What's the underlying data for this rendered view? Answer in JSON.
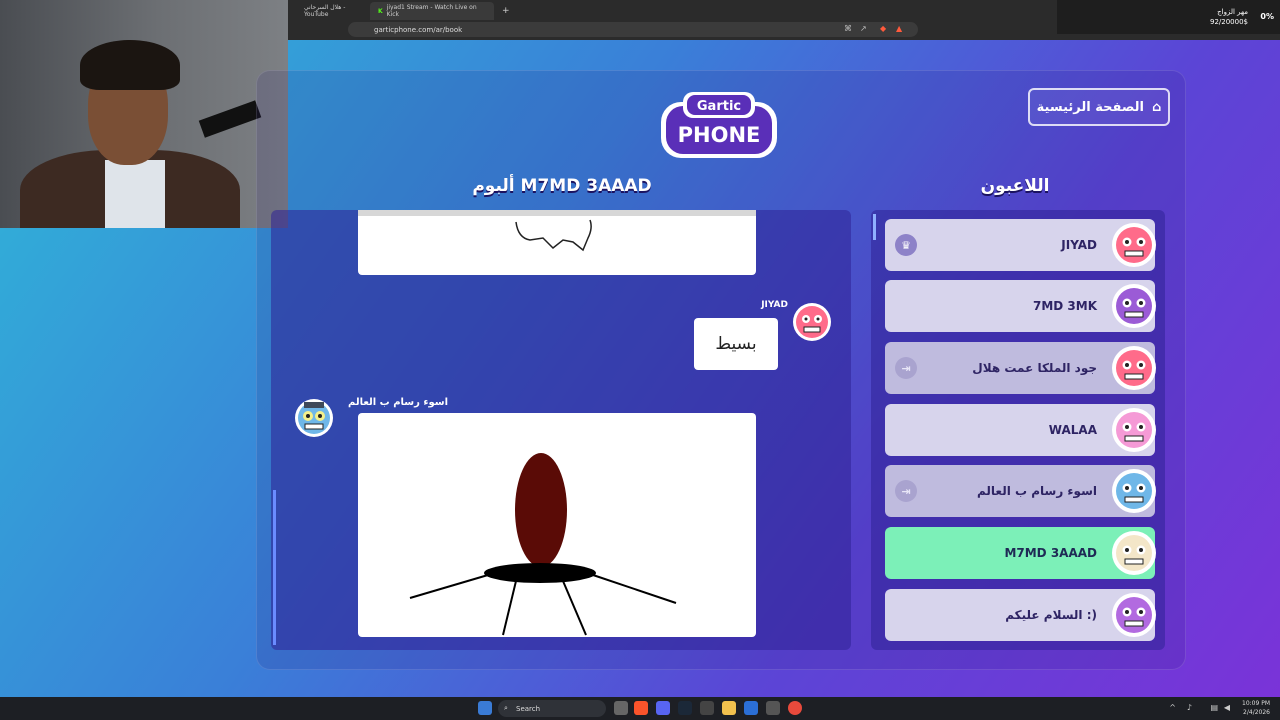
{
  "browser": {
    "tabs": [
      {
        "label": "هلال السرحاني - YouTube"
      },
      {
        "label": "jiyad1 Stream - Watch Live on Kick"
      }
    ],
    "new_tab_glyph": "+",
    "url": "garticphone.com/ar/book"
  },
  "notification": {
    "line1": "مهر الزواج",
    "line2": "92/20000$",
    "percent": "0%"
  },
  "header": {
    "logo_top": "Gartic",
    "logo_main": "PHONE",
    "home_label": "الصفحة الرئيسية"
  },
  "album": {
    "title": "ألبوم M7MD 3AAAD",
    "message_author": "JIYAD",
    "message_text": "بسيط",
    "drawing_author": "اسوء رسام ب العالم"
  },
  "players_panel": {
    "title": "اللاعبون",
    "players": [
      {
        "name": "JIYAD",
        "badge": "crown-icon",
        "state": "normal",
        "color": "#ff6b8a"
      },
      {
        "name": "7MD 3MK",
        "badge": "",
        "state": "normal",
        "color": "#9b5bd6"
      },
      {
        "name": "جود الملكا عمت هلال",
        "badge": "exit-icon",
        "state": "dim",
        "color": "#ff6b8a"
      },
      {
        "name": "WALAA",
        "badge": "",
        "state": "normal",
        "color": "#f59ad6"
      },
      {
        "name": "اسوء رسام ب العالم",
        "badge": "exit-icon",
        "state": "dim",
        "color": "#6fb7e8"
      },
      {
        "name": "M7MD 3AAAD",
        "badge": "",
        "state": "active",
        "color": "#f3e6c8"
      },
      {
        "name": "السلام عليكم :)",
        "badge": "",
        "state": "normal",
        "color": "#b26ae0"
      }
    ]
  },
  "taskbar": {
    "search_label": "Search",
    "time": "10:09 PM",
    "date": "2/4/2026"
  },
  "colors": {
    "active_player": "#7cf0b8",
    "panel": "#2f2396",
    "accent_gradient_start": "#2fb8d8",
    "accent_gradient_end": "#7a33d8"
  }
}
